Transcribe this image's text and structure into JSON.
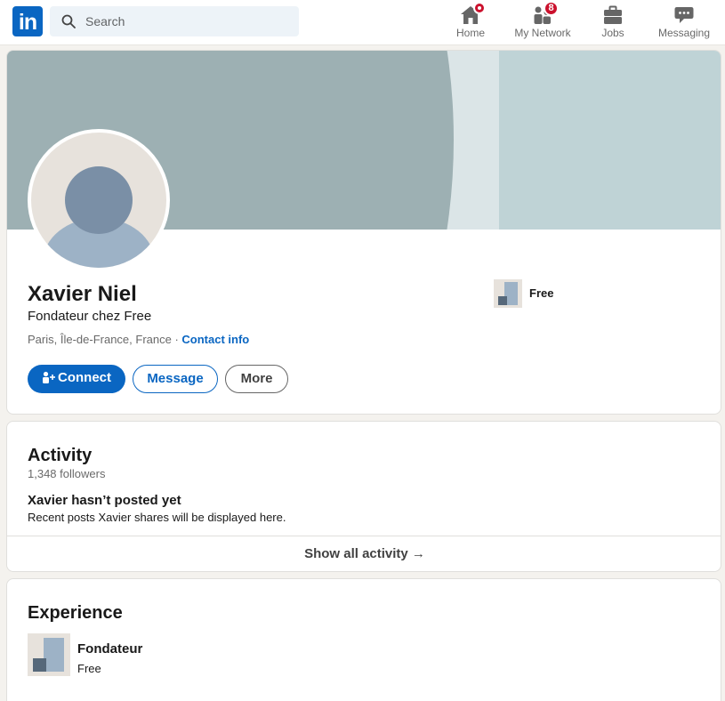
{
  "nav": {
    "logo_text": "in",
    "search_placeholder": "Search",
    "items": [
      {
        "label": "Home",
        "icon": "home-icon",
        "badge": ""
      },
      {
        "label": "My Network",
        "icon": "network-icon",
        "badge": "8"
      },
      {
        "label": "Jobs",
        "icon": "briefcase-icon",
        "badge": ""
      },
      {
        "label": "Messaging",
        "icon": "chat-icon",
        "badge": ""
      }
    ]
  },
  "profile": {
    "name": "Xavier Niel",
    "headline": "Fondateur chez Free",
    "location": "Paris, Île-de-France, France",
    "separator": " · ",
    "contact_info": "Contact info",
    "current_company": "Free",
    "actions": {
      "connect": "Connect",
      "message": "Message",
      "more": "More"
    }
  },
  "activity": {
    "title": "Activity",
    "followers": "1,348 followers",
    "empty_title": "Xavier hasn’t posted yet",
    "empty_sub": "Recent posts Xavier shares will be displayed here.",
    "show_all": "Show all activity →"
  },
  "experience": {
    "title": "Experience",
    "items": [
      {
        "title": "Fondateur",
        "company": "Free"
      }
    ]
  },
  "colors": {
    "brand_blue": "#0a66c2",
    "badge_red": "#cb112d",
    "page_bg": "#f4f2ee"
  }
}
